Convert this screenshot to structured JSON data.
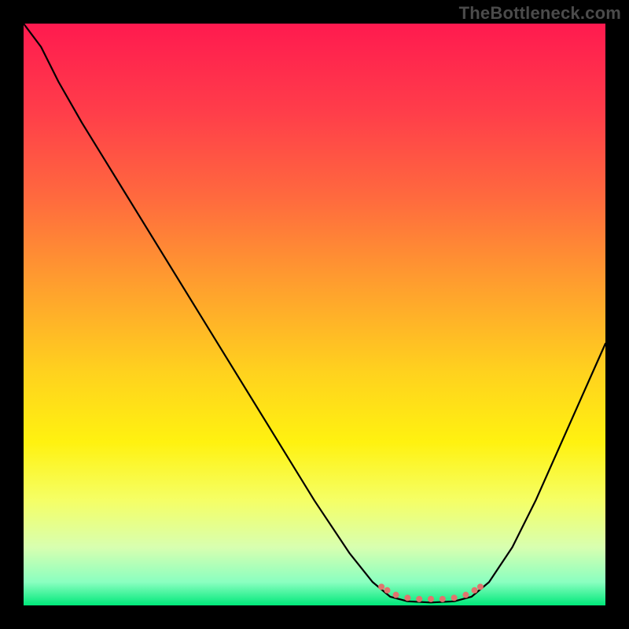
{
  "watermark": "TheBottleneck.com",
  "chart_data": {
    "type": "line",
    "title": "",
    "xlabel": "",
    "ylabel": "",
    "xlim": [
      0,
      100
    ],
    "ylim": [
      0,
      100
    ],
    "grid": false,
    "legend": false,
    "gradient_stops": [
      {
        "offset": 0.0,
        "color": "#ff1a4f"
      },
      {
        "offset": 0.15,
        "color": "#ff3d4a"
      },
      {
        "offset": 0.3,
        "color": "#ff6a3e"
      },
      {
        "offset": 0.45,
        "color": "#ff9f2e"
      },
      {
        "offset": 0.6,
        "color": "#ffd21e"
      },
      {
        "offset": 0.72,
        "color": "#fff210"
      },
      {
        "offset": 0.82,
        "color": "#f5ff66"
      },
      {
        "offset": 0.9,
        "color": "#d8ffb0"
      },
      {
        "offset": 0.96,
        "color": "#8affc0"
      },
      {
        "offset": 1.0,
        "color": "#00e87a"
      }
    ],
    "series": [
      {
        "name": "bottleneck-curve",
        "stroke": "#000000",
        "stroke_width": 2.2,
        "points": [
          {
            "x": 0.0,
            "y": 100.0
          },
          {
            "x": 3.0,
            "y": 96.0
          },
          {
            "x": 6.0,
            "y": 90.0
          },
          {
            "x": 10.0,
            "y": 83.0
          },
          {
            "x": 18.0,
            "y": 70.0
          },
          {
            "x": 26.0,
            "y": 57.0
          },
          {
            "x": 34.0,
            "y": 44.0
          },
          {
            "x": 42.0,
            "y": 31.0
          },
          {
            "x": 50.0,
            "y": 18.0
          },
          {
            "x": 56.0,
            "y": 9.0
          },
          {
            "x": 60.0,
            "y": 4.0
          },
          {
            "x": 63.0,
            "y": 1.5
          },
          {
            "x": 66.0,
            "y": 0.7
          },
          {
            "x": 70.0,
            "y": 0.5
          },
          {
            "x": 74.0,
            "y": 0.7
          },
          {
            "x": 77.0,
            "y": 1.5
          },
          {
            "x": 80.0,
            "y": 4.0
          },
          {
            "x": 84.0,
            "y": 10.0
          },
          {
            "x": 88.0,
            "y": 18.0
          },
          {
            "x": 92.0,
            "y": 27.0
          },
          {
            "x": 96.0,
            "y": 36.0
          },
          {
            "x": 100.0,
            "y": 45.0
          }
        ]
      },
      {
        "name": "highlight-band",
        "type": "scatter",
        "stroke": "#e0746e",
        "stroke_width": 8,
        "points": [
          {
            "x": 61.5,
            "y": 3.2
          },
          {
            "x": 62.5,
            "y": 2.6
          },
          {
            "x": 64.0,
            "y": 1.8
          },
          {
            "x": 66.0,
            "y": 1.3
          },
          {
            "x": 68.0,
            "y": 1.1
          },
          {
            "x": 70.0,
            "y": 1.1
          },
          {
            "x": 72.0,
            "y": 1.1
          },
          {
            "x": 74.0,
            "y": 1.3
          },
          {
            "x": 76.0,
            "y": 1.8
          },
          {
            "x": 77.5,
            "y": 2.6
          },
          {
            "x": 78.5,
            "y": 3.2
          }
        ]
      }
    ]
  }
}
